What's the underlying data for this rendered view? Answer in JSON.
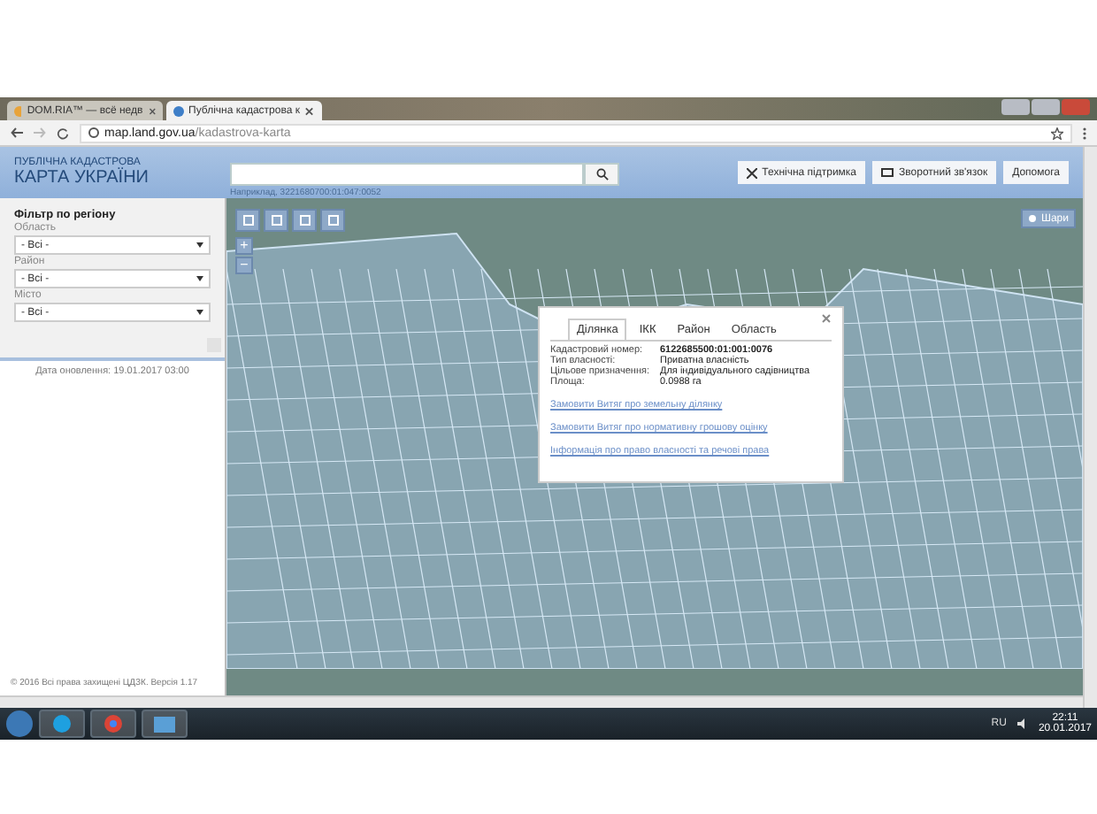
{
  "browser": {
    "tabs": [
      {
        "label": "DOM.RIA™ — всё недв",
        "selected": false
      },
      {
        "label": "Публічна кадастрова к",
        "selected": true
      }
    ],
    "url_host": "map.land.gov.ua",
    "url_path": "/kadastrova-karta"
  },
  "header": {
    "title_small": "ПУБЛІЧНА КАДАСТРОВА",
    "title_large": "КАРТА УКРАЇНИ",
    "search_hint": "Наприклад, 3221680700:01:047:0052",
    "buttons": [
      "Технічна підтримка",
      "Зворотний зв'язок",
      "Допомога"
    ]
  },
  "sidebar": {
    "heading": "Фільтр по регіону",
    "filters": [
      {
        "label": "Область",
        "value": "- Всі -"
      },
      {
        "label": "Район",
        "value": "- Всі -"
      },
      {
        "label": "Місто",
        "value": "- Всі -"
      }
    ],
    "updated": "Дата оновлення: 19.01.2017 03:00",
    "copyright": "© 2016 Всі права захищені ЦДЗК. Версія 1.17"
  },
  "map": {
    "zoom_in": "+",
    "zoom_out": "−",
    "layers_button": "Шари",
    "popup": {
      "tabs": [
        {
          "label": "Ділянка",
          "selected": true
        },
        {
          "label": "ІКК",
          "selected": false
        },
        {
          "label": "Район",
          "selected": false
        },
        {
          "label": "Область",
          "selected": false
        }
      ],
      "fields": [
        {
          "label": "Кадастровий номер:",
          "value": "6122685500:01:001:0076"
        },
        {
          "label": "Тип власності:",
          "value": "Приватна власність"
        },
        {
          "label": "Цільове призначення:",
          "value": "Для індивідуального садівництва"
        },
        {
          "label": "Площа:",
          "value": "0.0988 га"
        }
      ],
      "links": [
        "Замовити Витяг про земельну ділянку",
        "Замовити Витяг про нормативну грошову оцінку",
        "Інформація про право власності та речові права"
      ]
    }
  },
  "taskbar": {
    "language": "RU",
    "time": "22:11",
    "date": "20.01.2017"
  }
}
